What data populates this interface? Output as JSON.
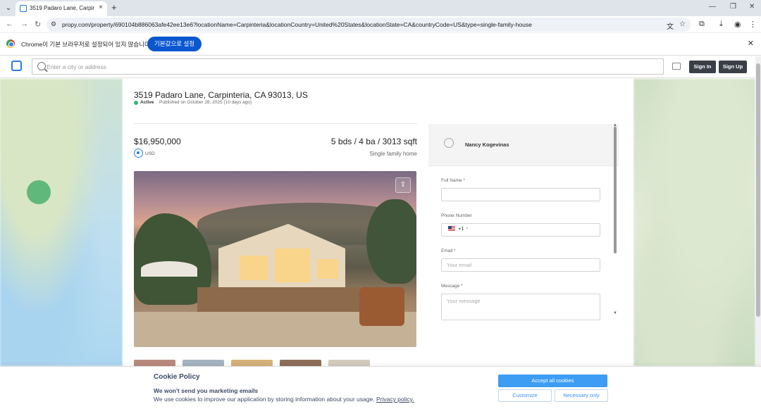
{
  "browser": {
    "tab_title": "3519 Padaro Lane, Carpinteria",
    "url": "propy.com/property/690104b886063afe42ee13e6?locationName=Carpinteria&locationCountry=United%20States&locationState=CA&countryCode=US&type=single-family-house",
    "infobar_text": "Chrome이 기본 브라우저로 설정되어 있지 않습니다",
    "infobar_button": "기본값으로 설정"
  },
  "header": {
    "search_placeholder": "Enter a city or address",
    "sign_in": "Sign In",
    "sign_up": "Sign Up"
  },
  "listing": {
    "address": "3519 Padaro Lane, Carpinteria, CA 93013, US",
    "status": "Active",
    "published": "Published on October 28, 2025 (10 days ago)",
    "price": "$16,950,000",
    "currency": "USD",
    "specs": "5 bds / 4 ba / 3013 sqft",
    "property_type": "Single family home"
  },
  "contact": {
    "agent_name": "Nancy Kogevinas",
    "full_name_label": "Full Name *",
    "phone_label": "Phone Number",
    "phone_code": "+1",
    "email_label": "Email *",
    "email_placeholder": "Your email",
    "message_label": "Message *",
    "message_placeholder": "Your message"
  },
  "cookie": {
    "title": "Cookie Policy",
    "subtitle": "We won't send you marketing emails",
    "text": "We use cookies to improve our application by storing information about your usage.",
    "link": "Privacy policy.",
    "accept": "Accept all cookies",
    "customize": "Customize",
    "necessary": "Necessary only"
  },
  "colors": {
    "accent": "#2a7de1",
    "status_active": "#36b37e",
    "cookie_accept": "#3d9df3"
  }
}
